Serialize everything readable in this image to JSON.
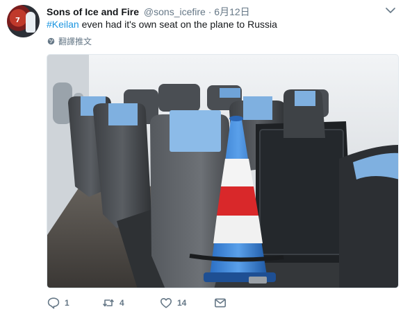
{
  "tweet": {
    "display_name": "Sons of Ice and Fire",
    "handle": "@sons_icefire",
    "separator": "·",
    "date": "6月12日",
    "hashtag": "#Keilan",
    "text_rest": " even had it's own seat on the plane to Russia",
    "translate_label": "翻譯推文",
    "avatar_number": "7"
  },
  "actions": {
    "reply_count": "1",
    "retweet_count": "4",
    "like_count": "14"
  },
  "icons": {
    "caret": "chevron-down-icon",
    "translate": "globe-icon",
    "reply": "reply-icon",
    "retweet": "retweet-icon",
    "like": "heart-icon",
    "dm": "envelope-icon"
  },
  "colors": {
    "link": "#1b95e0",
    "muted": "#657786",
    "text": "#14171a"
  }
}
